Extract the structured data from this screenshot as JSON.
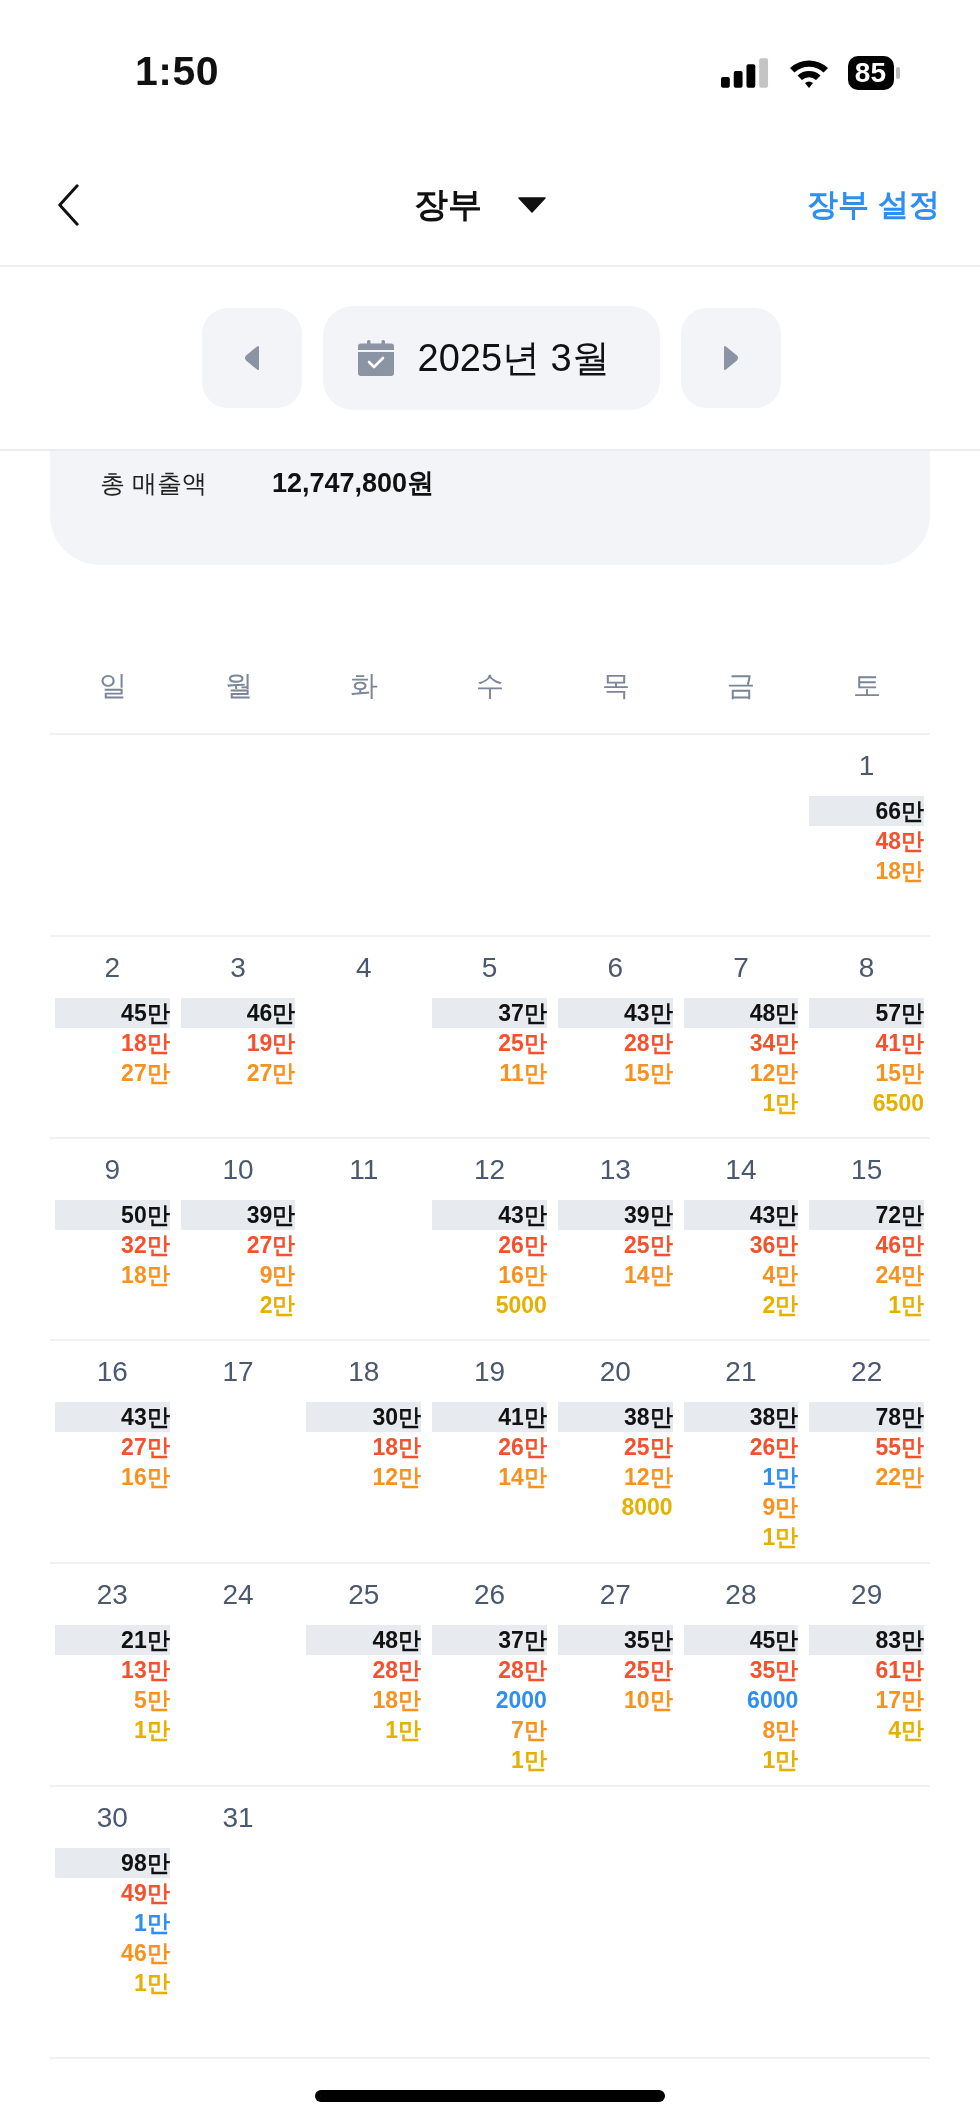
{
  "status_bar": {
    "time": "1:50",
    "battery": "85"
  },
  "header": {
    "title": "장부",
    "settings_link": "장부 설정"
  },
  "month_nav": {
    "label": "2025년 3월"
  },
  "summary": {
    "label": "총 매출액",
    "value": "12,747,800원"
  },
  "calendar": {
    "weekdays": [
      "일",
      "월",
      "화",
      "수",
      "목",
      "금",
      "토"
    ],
    "weeks": [
      {
        "days": [
          {
            "date": "1",
            "total": "66만",
            "items": [
              {
                "text": "48만",
                "color": "#f4512c"
              },
              {
                "text": "18만",
                "color": "#f8921f"
              }
            ]
          }
        ]
      },
      {
        "days": [
          {
            "date": "2",
            "total": "45만",
            "items": [
              {
                "text": "18만",
                "color": "#f4512c"
              },
              {
                "text": "27만",
                "color": "#f8921f"
              }
            ]
          },
          {
            "date": "3",
            "total": "46만",
            "items": [
              {
                "text": "19만",
                "color": "#f4512c"
              },
              {
                "text": "27만",
                "color": "#f8921f"
              }
            ]
          },
          {
            "date": "4"
          },
          {
            "date": "5",
            "total": "37만",
            "items": [
              {
                "text": "25만",
                "color": "#f4512c"
              },
              {
                "text": "11만",
                "color": "#f8921f"
              }
            ]
          },
          {
            "date": "6",
            "total": "43만",
            "items": [
              {
                "text": "28만",
                "color": "#f4512c"
              },
              {
                "text": "15만",
                "color": "#f8921f"
              }
            ]
          },
          {
            "date": "7",
            "total": "48만",
            "items": [
              {
                "text": "34만",
                "color": "#f4512c"
              },
              {
                "text": "12만",
                "color": "#f8921f"
              },
              {
                "text": "1만",
                "color": "#e6b000"
              }
            ]
          },
          {
            "date": "8",
            "total": "57만",
            "items": [
              {
                "text": "41만",
                "color": "#f4512c"
              },
              {
                "text": "15만",
                "color": "#f8921f"
              },
              {
                "text": "6500",
                "color": "#e6b000"
              }
            ]
          }
        ]
      },
      {
        "days": [
          {
            "date": "9",
            "total": "50만",
            "items": [
              {
                "text": "32만",
                "color": "#f4512c"
              },
              {
                "text": "18만",
                "color": "#f8921f"
              }
            ]
          },
          {
            "date": "10",
            "total": "39만",
            "items": [
              {
                "text": "27만",
                "color": "#f4512c"
              },
              {
                "text": "9만",
                "color": "#f8921f"
              },
              {
                "text": "2만",
                "color": "#e6b000"
              }
            ]
          },
          {
            "date": "11"
          },
          {
            "date": "12",
            "total": "43만",
            "items": [
              {
                "text": "26만",
                "color": "#f4512c"
              },
              {
                "text": "16만",
                "color": "#f8921f"
              },
              {
                "text": "5000",
                "color": "#e6b000"
              }
            ]
          },
          {
            "date": "13",
            "total": "39만",
            "items": [
              {
                "text": "25만",
                "color": "#f4512c"
              },
              {
                "text": "14만",
                "color": "#f8921f"
              }
            ]
          },
          {
            "date": "14",
            "total": "43만",
            "items": [
              {
                "text": "36만",
                "color": "#f4512c"
              },
              {
                "text": "4만",
                "color": "#f8921f"
              },
              {
                "text": "2만",
                "color": "#e6b000"
              }
            ]
          },
          {
            "date": "15",
            "total": "72만",
            "items": [
              {
                "text": "46만",
                "color": "#f4512c"
              },
              {
                "text": "24만",
                "color": "#f8921f"
              },
              {
                "text": "1만",
                "color": "#e6b000"
              }
            ]
          }
        ]
      },
      {
        "days": [
          {
            "date": "16",
            "total": "43만",
            "items": [
              {
                "text": "27만",
                "color": "#f4512c"
              },
              {
                "text": "16만",
                "color": "#f8921f"
              }
            ]
          },
          {
            "date": "17"
          },
          {
            "date": "18",
            "total": "30만",
            "items": [
              {
                "text": "18만",
                "color": "#f4512c"
              },
              {
                "text": "12만",
                "color": "#f8921f"
              }
            ]
          },
          {
            "date": "19",
            "total": "41만",
            "items": [
              {
                "text": "26만",
                "color": "#f4512c"
              },
              {
                "text": "14만",
                "color": "#f8921f"
              }
            ]
          },
          {
            "date": "20",
            "total": "38만",
            "items": [
              {
                "text": "25만",
                "color": "#f4512c"
              },
              {
                "text": "12만",
                "color": "#f8921f"
              },
              {
                "text": "8000",
                "color": "#e6b000"
              }
            ]
          },
          {
            "date": "21",
            "total": "38만",
            "items": [
              {
                "text": "26만",
                "color": "#f4512c"
              },
              {
                "text": "1만",
                "color": "#2e8ef2"
              },
              {
                "text": "9만",
                "color": "#f8921f"
              },
              {
                "text": "1만",
                "color": "#e6b000"
              }
            ]
          },
          {
            "date": "22",
            "total": "78만",
            "items": [
              {
                "text": "55만",
                "color": "#f4512c"
              },
              {
                "text": "22만",
                "color": "#f8921f"
              }
            ]
          }
        ]
      },
      {
        "days": [
          {
            "date": "23",
            "total": "21만",
            "items": [
              {
                "text": "13만",
                "color": "#f4512c"
              },
              {
                "text": "5만",
                "color": "#f8921f"
              },
              {
                "text": "1만",
                "color": "#e6b000"
              }
            ]
          },
          {
            "date": "24"
          },
          {
            "date": "25",
            "total": "48만",
            "items": [
              {
                "text": "28만",
                "color": "#f4512c"
              },
              {
                "text": "18만",
                "color": "#f8921f"
              },
              {
                "text": "1만",
                "color": "#e6b000"
              }
            ]
          },
          {
            "date": "26",
            "total": "37만",
            "items": [
              {
                "text": "28만",
                "color": "#f4512c"
              },
              {
                "text": "2000",
                "color": "#2e8ef2"
              },
              {
                "text": "7만",
                "color": "#f8921f"
              },
              {
                "text": "1만",
                "color": "#e6b000"
              }
            ]
          },
          {
            "date": "27",
            "total": "35만",
            "items": [
              {
                "text": "25만",
                "color": "#f4512c"
              },
              {
                "text": "10만",
                "color": "#f8921f"
              }
            ]
          },
          {
            "date": "28",
            "total": "45만",
            "items": [
              {
                "text": "35만",
                "color": "#f4512c"
              },
              {
                "text": "6000",
                "color": "#2e8ef2"
              },
              {
                "text": "8만",
                "color": "#f8921f"
              },
              {
                "text": "1만",
                "color": "#e6b000"
              }
            ]
          },
          {
            "date": "29",
            "total": "83만",
            "items": [
              {
                "text": "61만",
                "color": "#f4512c"
              },
              {
                "text": "17만",
                "color": "#f8921f"
              },
              {
                "text": "4만",
                "color": "#e6b000"
              }
            ]
          }
        ]
      },
      {
        "days": [
          {
            "date": "30",
            "total": "98만",
            "items": [
              {
                "text": "49만",
                "color": "#f4512c"
              },
              {
                "text": "1만",
                "color": "#2e8ef2"
              },
              {
                "text": "46만",
                "color": "#f8921f"
              },
              {
                "text": "1만",
                "color": "#e6b000"
              }
            ]
          },
          {
            "date": "31"
          }
        ]
      }
    ]
  }
}
